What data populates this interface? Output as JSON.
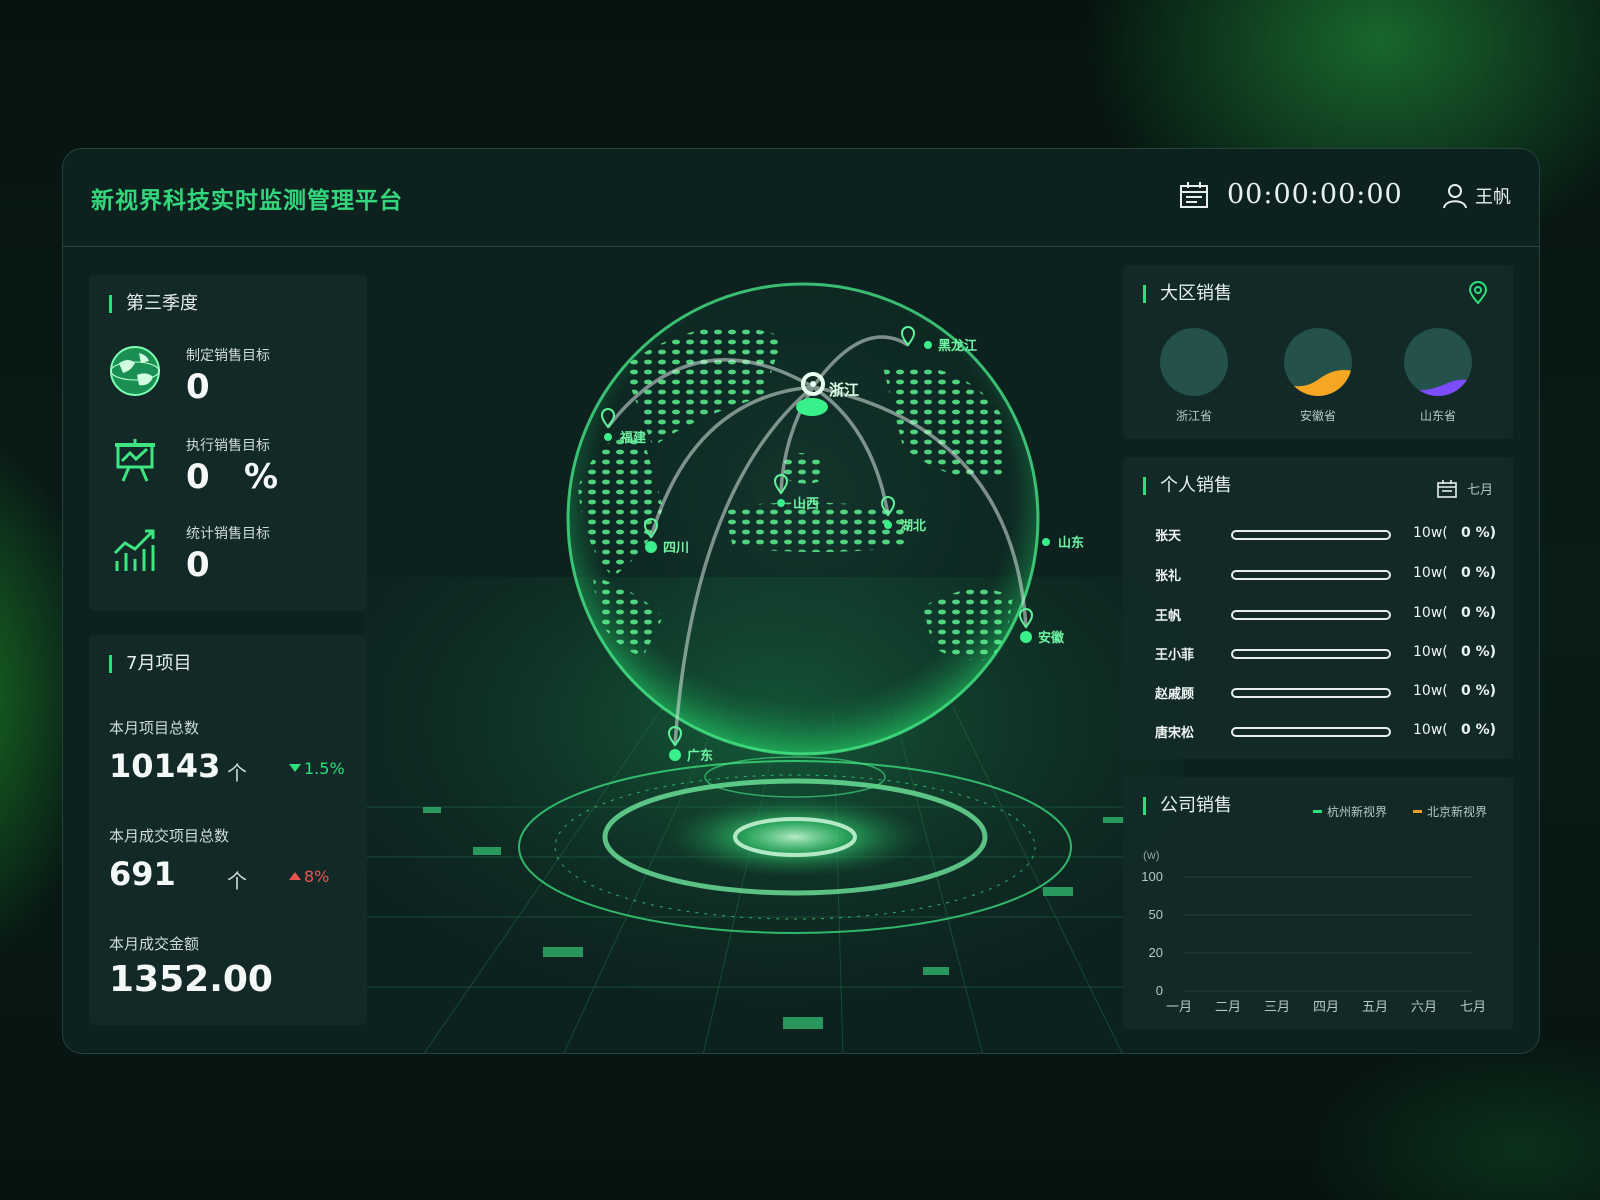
{
  "header": {
    "title": "新视界科技实时监测管理平台",
    "clock": "00:00:00:00",
    "user": "王帆"
  },
  "q3": {
    "title": "第三季度",
    "kpis": [
      {
        "label": "制定销售目标",
        "value": "0",
        "unit": "",
        "icon": "globe-icon"
      },
      {
        "label": "执行销售目标",
        "value": "0",
        "unit": "%",
        "icon": "presentation-board-icon"
      },
      {
        "label": "统计销售目标",
        "value": "0",
        "unit": "",
        "icon": "growth-chart-icon"
      }
    ]
  },
  "july": {
    "title": "7月项目",
    "stats": [
      {
        "label": "本月项目总数",
        "value": "10143",
        "arrow": "个",
        "change": "1.5%",
        "direction": "down"
      },
      {
        "label": "本月成交项目总数",
        "value": "691",
        "arrow": "个",
        "change": "8%",
        "direction": "up"
      },
      {
        "label": "本月成交金额",
        "value": "1352.00"
      }
    ]
  },
  "globe": {
    "hub": "浙江",
    "cities": [
      "黑龙江",
      "福建",
      "山西",
      "湖北",
      "山东",
      "四川",
      "安徽",
      "广东"
    ]
  },
  "region": {
    "title": "大区销售",
    "provinces": [
      {
        "name": "浙江省",
        "fill_color": "#24514a"
      },
      {
        "name": "安徽省",
        "fill_color": "#f5a623"
      },
      {
        "name": "山东省",
        "fill_color": "#7c4dff"
      }
    ]
  },
  "person": {
    "title": "个人销售",
    "month": "七月",
    "rows": [
      {
        "name": "张天",
        "amount": "10w(",
        "percent": "0 %)",
        "progress": 0
      },
      {
        "name": "张礼",
        "amount": "10w(",
        "percent": "0 %)",
        "progress": 0
      },
      {
        "name": "王帆",
        "amount": "10w(",
        "percent": "0 %)",
        "progress": 0
      },
      {
        "name": "王小菲",
        "amount": "10w(",
        "percent": "0 %)",
        "progress": 0
      },
      {
        "name": "赵戚顾",
        "amount": "10w(",
        "percent": "0 %)",
        "progress": 0
      },
      {
        "name": "唐宋松",
        "amount": "10w(",
        "percent": "0 %)",
        "progress": 0
      }
    ]
  },
  "company": {
    "title": "公司销售",
    "legend": [
      {
        "name": "杭州新视界",
        "color": "#2ee07a"
      },
      {
        "name": "北京新视界",
        "color": "#f39c2a"
      }
    ]
  },
  "chart_data": {
    "type": "line",
    "title": "",
    "ylabel": "(w)",
    "y_ticks": [
      "100",
      "50",
      "20",
      "0"
    ],
    "categories": [
      "一月",
      "二月",
      "三月",
      "四月",
      "五月",
      "六月",
      "七月"
    ],
    "series": [
      {
        "name": "杭州新视界",
        "values": []
      },
      {
        "name": "北京新视界",
        "values": []
      }
    ]
  }
}
